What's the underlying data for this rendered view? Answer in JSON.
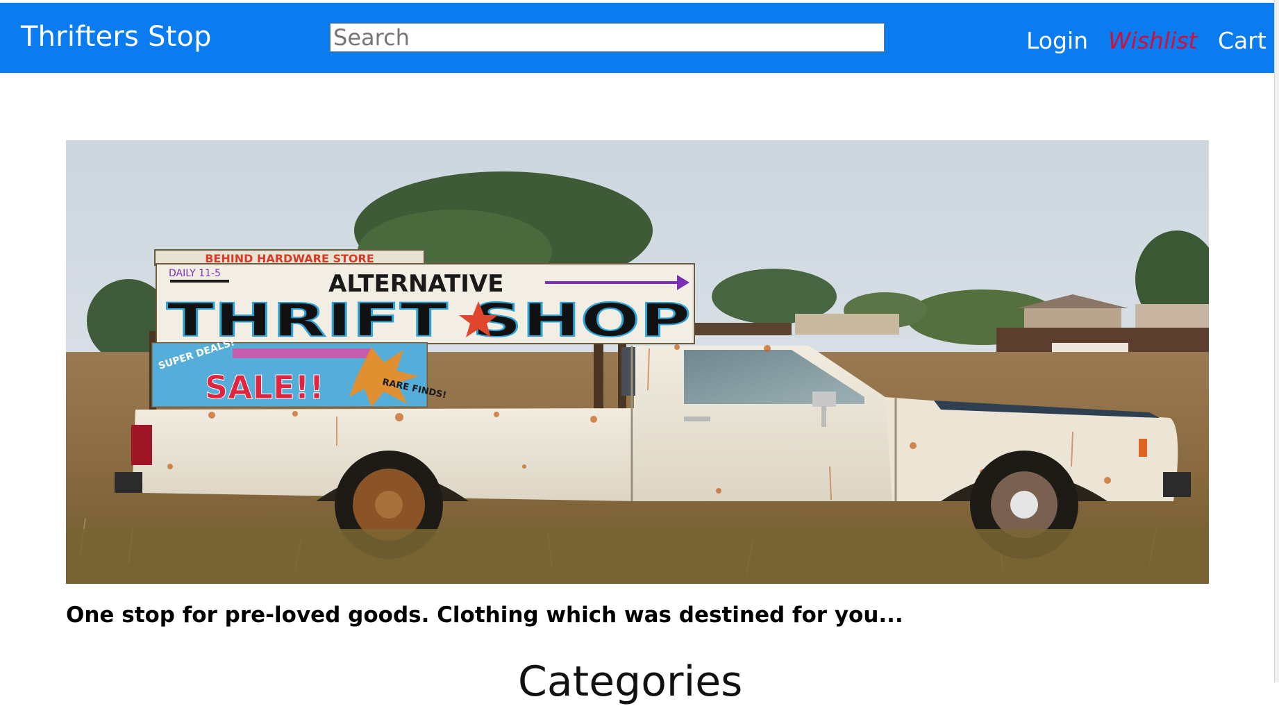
{
  "navbar": {
    "brand": "Thrifters Stop",
    "search": {
      "placeholder": "Search",
      "value": ""
    },
    "links": {
      "login": "Login",
      "wishlist": "Wishlist",
      "cart": "Cart"
    }
  },
  "colors": {
    "navbar_bg": "#0a7cf0",
    "wishlist_accent": "#d0103a"
  },
  "hero": {
    "sign_lines": [
      "BEHIND HARDWARE STORE",
      "DAILY 11-5",
      "ALTERNATIVE",
      "THRIFT SHOP",
      "SUPER DEALS!",
      "SALE!!",
      "RARE FINDS!"
    ]
  },
  "main": {
    "tagline": "One stop for pre-loved goods. Clothing which was destined for you...",
    "section_title": "Categories"
  }
}
